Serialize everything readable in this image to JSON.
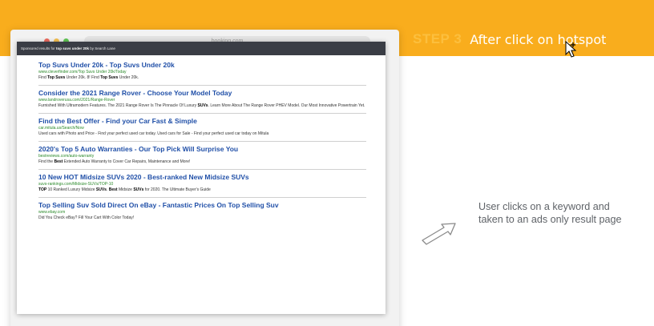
{
  "step": {
    "number": "STEP 3",
    "text": "After click on hotspot"
  },
  "browser": {
    "address": "booking.com"
  },
  "sponsored_bar": {
    "prefix": "Sponsored results for ",
    "query": "top suvs under 20k",
    "suffix": " by Search Lane"
  },
  "ads": [
    {
      "title": "Top Suvs Under 20k - Top Suvs Under 20k",
      "url": "www.cleverfinder.com/Top Suvs Under 20k/Today",
      "desc_html": "Find <b>Top Suvs</b> Under 20k. 8! Find <b>Top Suvs</b> Under 20k."
    },
    {
      "title": "Consider the 2021 Range Rover - Choose Your Model Today",
      "url": "www.landroverusa.com/2021/Range-Rover",
      "desc_html": "Furnished With Ultramodern Features. The 2021 Range Rover Is The Pinnacle Of Luxury <b>SUVs</b>. Learn More About The Range Rover PHEV Model. Our Most Innovative Powertrain Yet."
    },
    {
      "title": "Find the Best Offer - Find your Car Fast & Simple",
      "url": "car.mitula.us/Search/Now",
      "desc_html": "Used cars with Photo and Price - Find your perfect used car today. Used cars for Sale - Find your perfect used car today on Mitula"
    },
    {
      "title": "2020's Top 5 Auto Warranties - Our Top Pick Will Surprise You",
      "url": "bestreviews.com/auto-warranty",
      "desc_html": "Find the <b>Best</b> Extended Auto Warranty to Cover Car Repairs, Maintenance and More!"
    },
    {
      "title": "10 New HOT Midsize SUVs 2020 - Best-ranked New Midsize SUVs",
      "url": "suvs-rankings.com/Midsize-SUVs/TOP-10",
      "desc_html": "<b>TOP</b> 10 Ranked Luxury Midsize <b>SUVs</b>. <b>Best</b> Midsize <b>SUVs</b> for 2020. The Ultimate Buyer's Guide"
    },
    {
      "title": "Top Selling Suv Sold Direct On eBay - Fantastic Prices On Top Selling Suv",
      "url": "www.ebay.com",
      "desc_html": "Did You Check eBay? Fill Your Cart With Color Today!"
    }
  ],
  "info": {
    "line1": "User clicks on a keyword and",
    "line2": "taken to an ads only result page"
  },
  "icons": {
    "arrow": "up-right-arrow-icon",
    "cursor": "move-cursor-icon"
  },
  "colors": {
    "band": "#f9ad1d",
    "step_number": "#fcbf3e",
    "ad_title": "#2150a8",
    "ad_url": "#2a8a2a",
    "sponsored_bar": "#3a3d45"
  }
}
